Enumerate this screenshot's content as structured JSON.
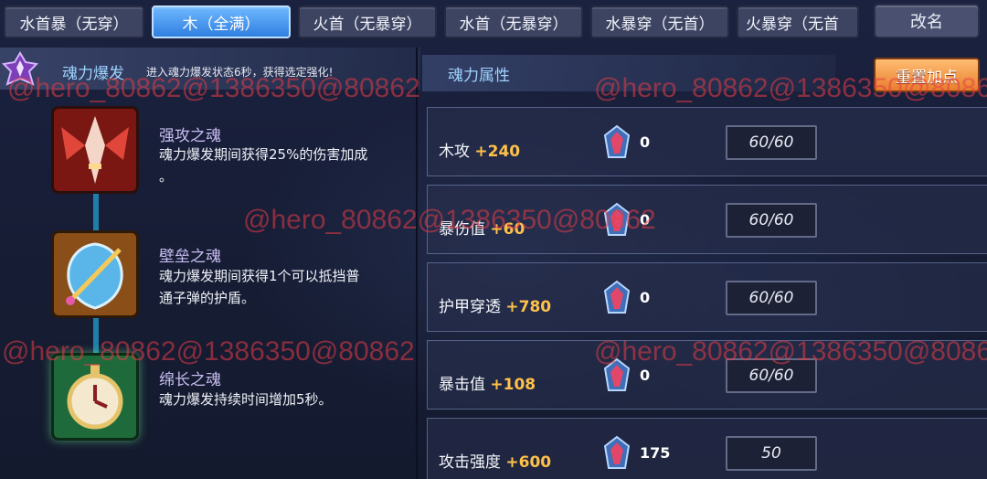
{
  "tabs": [
    "水首暴（无穿）",
    "木（全满）",
    "火首（无暴穿）",
    "水首（无暴穿）",
    "水暴穿（无首）",
    "火暴穿（无首"
  ],
  "active_tab_index": 1,
  "rename_label": "改名",
  "burst": {
    "title": "魂力爆发",
    "description": "进入魂力爆发状态6秒，获得选定强化!"
  },
  "attr_panel_title": "魂力属性",
  "reset_label": "重置加点",
  "skills": [
    {
      "name": "强攻之魂",
      "desc_line1": "魂力爆发期间获得25%的伤害加成",
      "desc_line2": "。",
      "icon": "red-winged-sword-icon"
    },
    {
      "name": "壁垒之魂",
      "desc_line1": "魂力爆发期间获得1个可以抵挡普",
      "desc_line2": "通子弹的护盾。",
      "icon": "blue-shield-icon"
    },
    {
      "name": "绵长之魂",
      "desc_line1": "魂力爆发持续时间增加5秒。",
      "desc_line2": "",
      "icon": "green-stopwatch-icon"
    }
  ],
  "attributes": [
    {
      "label": "木攻",
      "bonus": "+240",
      "gems": "0",
      "level": "60/60"
    },
    {
      "label": "暴伤值",
      "bonus": "+60",
      "gems": "0",
      "level": "60/60"
    },
    {
      "label": "护甲穿透",
      "bonus": "+780",
      "gems": "0",
      "level": "60/60"
    },
    {
      "label": "暴击值",
      "bonus": "+108",
      "gems": "0",
      "level": "60/60"
    },
    {
      "label": "攻击强度",
      "bonus": "+600",
      "gems": "175",
      "level": "50"
    }
  ],
  "watermark": "@hero_80862@1386350@80862",
  "colors": {
    "accent_tab": "#3f8ef0",
    "bonus": "#ffc14a",
    "reset": "#f09440",
    "skill_name": "#c7bdf0"
  }
}
